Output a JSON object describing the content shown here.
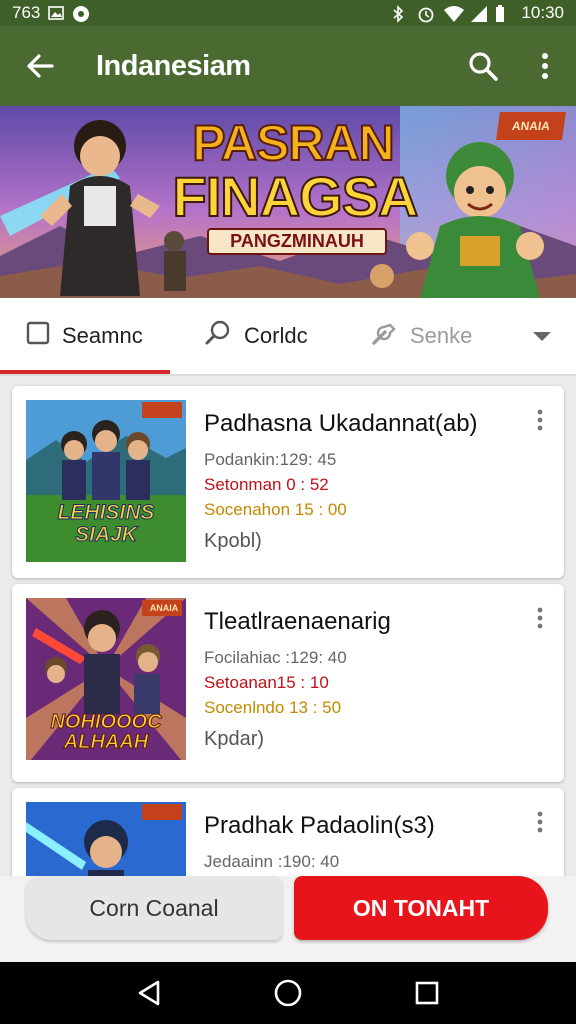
{
  "status_bar": {
    "left_text": "763",
    "time": "10:30",
    "icons": [
      "gallery-icon",
      "record-icon",
      "bluetooth-icon",
      "alarm-icon",
      "wifi-icon",
      "signal-icon",
      "battery-icon"
    ]
  },
  "app_bar": {
    "title": "Indanesiam",
    "icons": [
      "back-arrow-icon",
      "search-icon",
      "more-vert-icon"
    ],
    "color": "#4a6a31"
  },
  "banner": {
    "title_line1": "PASRAN",
    "title_line2": "FINAGSA",
    "subtitle": "PANGZMINAUH",
    "corner_flag": "ANAIA"
  },
  "tabs": [
    {
      "label": "Seamnc",
      "icon": "checkbox-icon",
      "active": true
    },
    {
      "label": "Corldc",
      "icon": "search-icon",
      "active": false
    },
    {
      "label": "Senke",
      "icon": "wrench-icon",
      "active": false,
      "disabled": true
    },
    {
      "label": "",
      "icon": "dropdown-arrow-icon",
      "active": false
    }
  ],
  "accent": "#d42a2a",
  "games": [
    {
      "name": "Padhasna Ukadannat(ab)",
      "line1": "Podankin:129: 45",
      "line2": "Setonman 0 : 52",
      "line3": "Socenahon 15 : 00",
      "cta": "Kpobl)",
      "thumb_text": "LEHISINS SIAJK"
    },
    {
      "name": "Tleatlraenaenarig",
      "line1": "Focilahiac :129: 40",
      "line2": "Setoanan15 : 10",
      "line3": "Socenlndo 13 : 50",
      "cta": "Kpdar)",
      "thumb_text": "NOHIOOOC ALHAAH",
      "thumb_flag": "ANAIA"
    },
    {
      "name": "Pradhak Padaolin(s3)",
      "line1": "Jedaainn :190: 40",
      "line2": "",
      "line3": "",
      "cta": "",
      "thumb_text": ""
    }
  ],
  "bottom_buttons": {
    "secondary": "Corn Coanal",
    "primary": "ON TONAHT",
    "primary_color": "#e8141b"
  },
  "nav_bar": {
    "icons": [
      "nav-back-icon",
      "nav-home-icon",
      "nav-recents-icon"
    ]
  }
}
